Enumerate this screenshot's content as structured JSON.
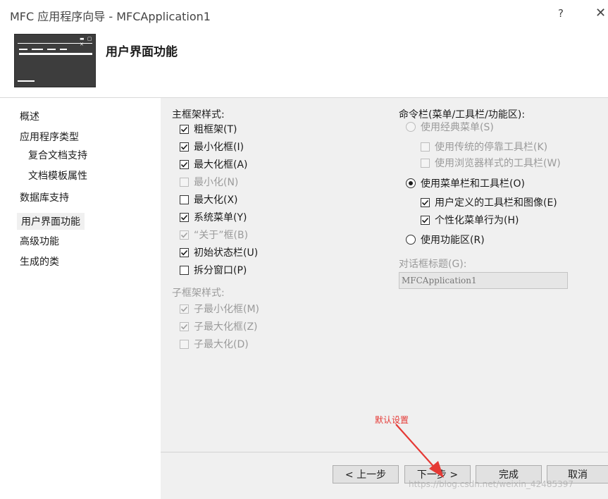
{
  "window": {
    "title": "MFC 应用程序向导 - MFCApplication1",
    "help_label": "?",
    "close_label": "✕"
  },
  "header": {
    "heading": "用户界面功能"
  },
  "sidebar": {
    "items": [
      {
        "label": "概述"
      },
      {
        "label": "应用程序类型"
      },
      {
        "label": "复合文档支持"
      },
      {
        "label": "文档模板属性"
      },
      {
        "label": "数据库支持"
      },
      {
        "label": "用户界面功能",
        "active": true
      },
      {
        "label": "高级功能"
      },
      {
        "label": "生成的类"
      }
    ]
  },
  "main_frame": {
    "title": "主框架样式:",
    "options": [
      {
        "label": "粗框架(T)",
        "checked": true,
        "enabled": true
      },
      {
        "label": "最小化框(I)",
        "checked": true,
        "enabled": true
      },
      {
        "label": "最大化框(A)",
        "checked": true,
        "enabled": true
      },
      {
        "label": "最小化(N)",
        "checked": false,
        "enabled": false
      },
      {
        "label": "最大化(X)",
        "checked": false,
        "enabled": true
      },
      {
        "label": "系统菜单(Y)",
        "checked": true,
        "enabled": true
      },
      {
        "label": "“关于”框(B)",
        "checked": true,
        "enabled": false
      },
      {
        "label": "初始状态栏(U)",
        "checked": true,
        "enabled": true
      },
      {
        "label": "拆分窗口(P)",
        "checked": false,
        "enabled": true
      }
    ]
  },
  "child_frame": {
    "title": "子框架样式:",
    "options": [
      {
        "label": "子最小化框(M)",
        "checked": true,
        "enabled": false
      },
      {
        "label": "子最大化框(Z)",
        "checked": true,
        "enabled": false
      },
      {
        "label": "子最大化(D)",
        "checked": false,
        "enabled": false
      }
    ]
  },
  "command_bar": {
    "title": "命令栏(菜单/工具栏/功能区):",
    "classic_menu": {
      "label": "使用经典菜单(S)",
      "selected": false,
      "enabled": false
    },
    "classic_sub": [
      {
        "label": "使用传统的停靠工具栏(K)",
        "checked": false,
        "enabled": false
      },
      {
        "label": "使用浏览器样式的工具栏(W)",
        "checked": false,
        "enabled": false
      }
    ],
    "menubar_toolbar": {
      "label": "使用菜单栏和工具栏(O)",
      "selected": true,
      "enabled": true
    },
    "menubar_sub": [
      {
        "label": "用户定义的工具栏和图像(E)",
        "checked": true,
        "enabled": true
      },
      {
        "label": "个性化菜单行为(H)",
        "checked": true,
        "enabled": true
      }
    ],
    "ribbon": {
      "label": "使用功能区(R)",
      "selected": false,
      "enabled": true
    }
  },
  "dialog_caption": {
    "label": "对话框标题(G):",
    "value": "MFCApplication1"
  },
  "buttons": {
    "prev": "< 上一步",
    "next": "下一步 >",
    "finish": "完成",
    "cancel": "取消"
  },
  "annotation": {
    "text": "默认设置",
    "color": "#e53935"
  },
  "watermark": "https://blog.csdn.net/weixin_42485397"
}
